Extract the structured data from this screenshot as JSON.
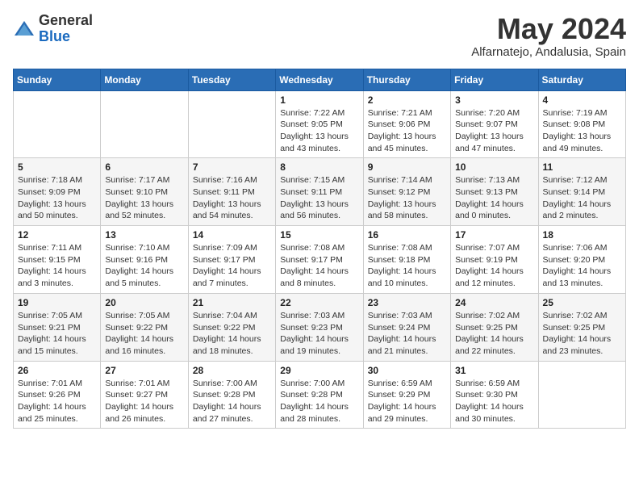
{
  "header": {
    "logo_general": "General",
    "logo_blue": "Blue",
    "month_year": "May 2024",
    "location": "Alfarnatejo, Andalusia, Spain"
  },
  "weekdays": [
    "Sunday",
    "Monday",
    "Tuesday",
    "Wednesday",
    "Thursday",
    "Friday",
    "Saturday"
  ],
  "weeks": [
    [
      {
        "day": "",
        "info": ""
      },
      {
        "day": "",
        "info": ""
      },
      {
        "day": "",
        "info": ""
      },
      {
        "day": "1",
        "info": "Sunrise: 7:22 AM\nSunset: 9:05 PM\nDaylight: 13 hours\nand 43 minutes."
      },
      {
        "day": "2",
        "info": "Sunrise: 7:21 AM\nSunset: 9:06 PM\nDaylight: 13 hours\nand 45 minutes."
      },
      {
        "day": "3",
        "info": "Sunrise: 7:20 AM\nSunset: 9:07 PM\nDaylight: 13 hours\nand 47 minutes."
      },
      {
        "day": "4",
        "info": "Sunrise: 7:19 AM\nSunset: 9:08 PM\nDaylight: 13 hours\nand 49 minutes."
      }
    ],
    [
      {
        "day": "5",
        "info": "Sunrise: 7:18 AM\nSunset: 9:09 PM\nDaylight: 13 hours\nand 50 minutes."
      },
      {
        "day": "6",
        "info": "Sunrise: 7:17 AM\nSunset: 9:10 PM\nDaylight: 13 hours\nand 52 minutes."
      },
      {
        "day": "7",
        "info": "Sunrise: 7:16 AM\nSunset: 9:11 PM\nDaylight: 13 hours\nand 54 minutes."
      },
      {
        "day": "8",
        "info": "Sunrise: 7:15 AM\nSunset: 9:11 PM\nDaylight: 13 hours\nand 56 minutes."
      },
      {
        "day": "9",
        "info": "Sunrise: 7:14 AM\nSunset: 9:12 PM\nDaylight: 13 hours\nand 58 minutes."
      },
      {
        "day": "10",
        "info": "Sunrise: 7:13 AM\nSunset: 9:13 PM\nDaylight: 14 hours\nand 0 minutes."
      },
      {
        "day": "11",
        "info": "Sunrise: 7:12 AM\nSunset: 9:14 PM\nDaylight: 14 hours\nand 2 minutes."
      }
    ],
    [
      {
        "day": "12",
        "info": "Sunrise: 7:11 AM\nSunset: 9:15 PM\nDaylight: 14 hours\nand 3 minutes."
      },
      {
        "day": "13",
        "info": "Sunrise: 7:10 AM\nSunset: 9:16 PM\nDaylight: 14 hours\nand 5 minutes."
      },
      {
        "day": "14",
        "info": "Sunrise: 7:09 AM\nSunset: 9:17 PM\nDaylight: 14 hours\nand 7 minutes."
      },
      {
        "day": "15",
        "info": "Sunrise: 7:08 AM\nSunset: 9:17 PM\nDaylight: 14 hours\nand 8 minutes."
      },
      {
        "day": "16",
        "info": "Sunrise: 7:08 AM\nSunset: 9:18 PM\nDaylight: 14 hours\nand 10 minutes."
      },
      {
        "day": "17",
        "info": "Sunrise: 7:07 AM\nSunset: 9:19 PM\nDaylight: 14 hours\nand 12 minutes."
      },
      {
        "day": "18",
        "info": "Sunrise: 7:06 AM\nSunset: 9:20 PM\nDaylight: 14 hours\nand 13 minutes."
      }
    ],
    [
      {
        "day": "19",
        "info": "Sunrise: 7:05 AM\nSunset: 9:21 PM\nDaylight: 14 hours\nand 15 minutes."
      },
      {
        "day": "20",
        "info": "Sunrise: 7:05 AM\nSunset: 9:22 PM\nDaylight: 14 hours\nand 16 minutes."
      },
      {
        "day": "21",
        "info": "Sunrise: 7:04 AM\nSunset: 9:22 PM\nDaylight: 14 hours\nand 18 minutes."
      },
      {
        "day": "22",
        "info": "Sunrise: 7:03 AM\nSunset: 9:23 PM\nDaylight: 14 hours\nand 19 minutes."
      },
      {
        "day": "23",
        "info": "Sunrise: 7:03 AM\nSunset: 9:24 PM\nDaylight: 14 hours\nand 21 minutes."
      },
      {
        "day": "24",
        "info": "Sunrise: 7:02 AM\nSunset: 9:25 PM\nDaylight: 14 hours\nand 22 minutes."
      },
      {
        "day": "25",
        "info": "Sunrise: 7:02 AM\nSunset: 9:25 PM\nDaylight: 14 hours\nand 23 minutes."
      }
    ],
    [
      {
        "day": "26",
        "info": "Sunrise: 7:01 AM\nSunset: 9:26 PM\nDaylight: 14 hours\nand 25 minutes."
      },
      {
        "day": "27",
        "info": "Sunrise: 7:01 AM\nSunset: 9:27 PM\nDaylight: 14 hours\nand 26 minutes."
      },
      {
        "day": "28",
        "info": "Sunrise: 7:00 AM\nSunset: 9:28 PM\nDaylight: 14 hours\nand 27 minutes."
      },
      {
        "day": "29",
        "info": "Sunrise: 7:00 AM\nSunset: 9:28 PM\nDaylight: 14 hours\nand 28 minutes."
      },
      {
        "day": "30",
        "info": "Sunrise: 6:59 AM\nSunset: 9:29 PM\nDaylight: 14 hours\nand 29 minutes."
      },
      {
        "day": "31",
        "info": "Sunrise: 6:59 AM\nSunset: 9:30 PM\nDaylight: 14 hours\nand 30 minutes."
      },
      {
        "day": "",
        "info": ""
      }
    ]
  ]
}
